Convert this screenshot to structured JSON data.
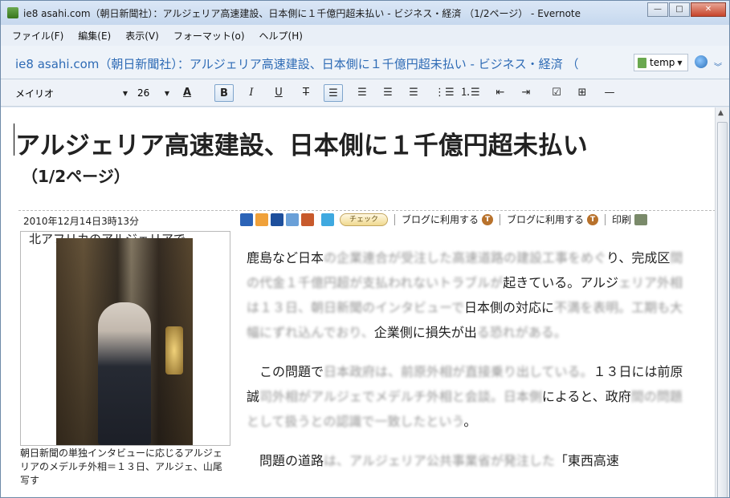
{
  "window": {
    "title": "ie8 asahi.com（朝日新聞社）：アルジェリア高速建設、日本側に１千億円超未払い - ビジネス・経済 （1/2ページ） - Evernote",
    "controls": {
      "minimize": "—",
      "maximize": "□",
      "close": "✕"
    }
  },
  "menu": [
    "ファイル(F)",
    "編集(E)",
    "表示(V)",
    "フォーマット(o)",
    "ヘルプ(H)"
  ],
  "note": {
    "title": "ie8 asahi.com（朝日新聞社）：アルジェリア高速建設、日本側に１千億円超未払い - ビジネス・経済 （",
    "notebook": "temp"
  },
  "toolbar": {
    "font": "メイリオ",
    "size": "26",
    "buttons": {
      "font_color": "A",
      "bold": "B",
      "italic": "I",
      "underline": "U",
      "strike": "T"
    }
  },
  "article": {
    "headline": "アルジェリア高速建設、日本側に１千億円超未払い",
    "page_indicator": "（1/2ページ）",
    "date": "2010年12月14日3時13分",
    "check_label": "チェック",
    "blog_link_1": "ブログに利用する",
    "blog_link_2": "ブログに利用する",
    "print_label": "印刷",
    "photo_lead": "北アフリカのアルジェリアで",
    "caption": "朝日新聞の単独インタビューに応じるアルジェリアのメデルチ外相＝１３日、アルジェ、山尾写す",
    "paragraphs": [
      {
        "visible_1": "鹿島など日本",
        "blur_1": "の企業連合が受注した高速道路の建設工事をめぐ",
        "visible_2": "り、完成区",
        "blur_2": "間の代金１千億円超が支払われないトラブルが",
        "visible_3": "起きている。アルジ",
        "blur_3": "ェリア外相は１３日、朝日新聞のインタビューで",
        "visible_4": "日本側の対応に",
        "blur_4": "不満を表明。工期も大幅にずれ込んでおり、",
        "visible_5": "企業側に損失が出",
        "blur_5": "る恐れがある。"
      },
      {
        "visible_1": "この問題で",
        "blur_1": "日本政府は、前原外相が直接乗り出している。",
        "visible_2": "１３日には前原誠",
        "blur_2": "司外相がアルジェでメデルチ外相と会談。日本側",
        "visible_3": "によると、政府",
        "blur_3": "間の問題として扱うとの認識で一致したという",
        "visible_4": "。"
      },
      {
        "visible_1": "問題の道路",
        "blur_1": "は、アルジェリア公共事業省が発注した",
        "visible_2": "「東西高速"
      }
    ]
  }
}
